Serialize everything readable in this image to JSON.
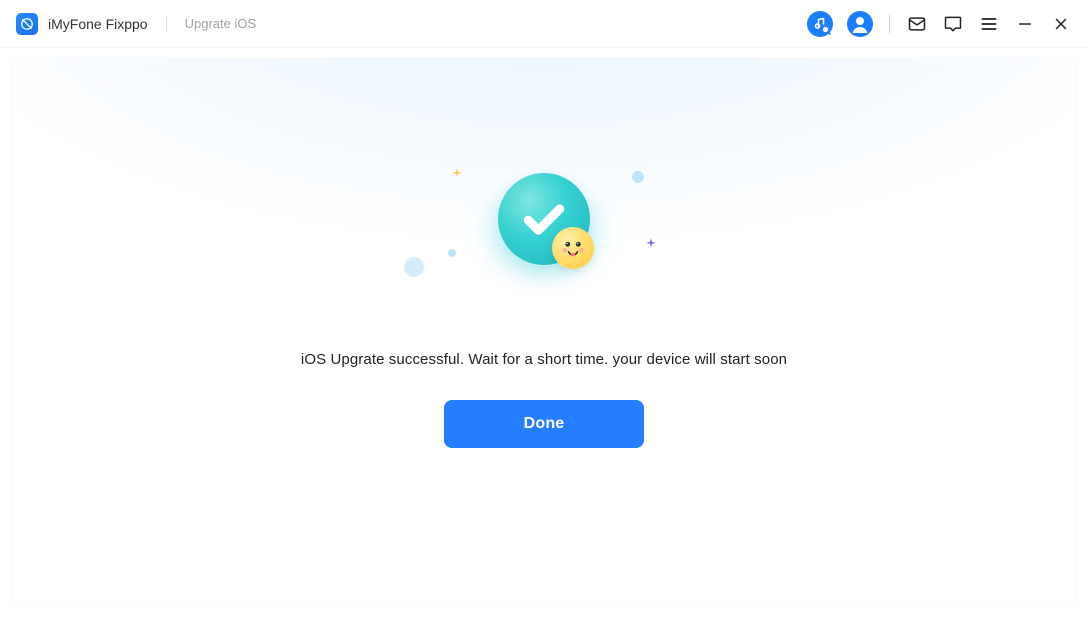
{
  "header": {
    "app_name": "iMyFone Fixppo",
    "subtitle": "Upgrate iOS"
  },
  "icons": {
    "music_tooltip": "Music",
    "account_tooltip": "Account",
    "mail_tooltip": "Feedback",
    "chat_tooltip": "Support",
    "menu_tooltip": "Menu",
    "minimize_tooltip": "Minimize",
    "close_tooltip": "Close"
  },
  "main": {
    "message": "iOS Upgrate successful. Wait for a short time. your device will start soon",
    "done_label": "Done"
  },
  "colors": {
    "primary": "#267dff",
    "check_green": "#2fd1cf"
  }
}
